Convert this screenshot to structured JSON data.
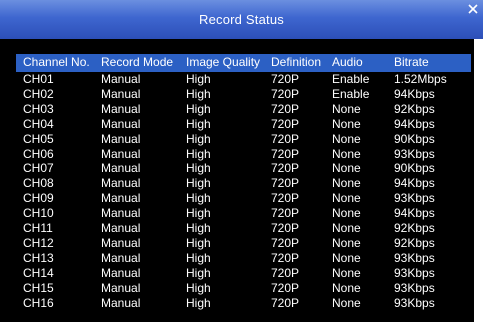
{
  "window": {
    "title": "Record Status",
    "close_icon": "close-icon"
  },
  "table": {
    "headers": [
      "Channel No.",
      "Record Mode",
      "Image Quality",
      "Definition",
      "Audio",
      "Bitrate"
    ],
    "rows": [
      [
        "CH01",
        "Manual",
        "High",
        "720P",
        "Enable",
        "1.52Mbps"
      ],
      [
        "CH02",
        "Manual",
        "High",
        "720P",
        "Enable",
        "94Kbps"
      ],
      [
        "CH03",
        "Manual",
        "High",
        "720P",
        "None",
        "92Kbps"
      ],
      [
        "CH04",
        "Manual",
        "High",
        "720P",
        "None",
        "94Kbps"
      ],
      [
        "CH05",
        "Manual",
        "High",
        "720P",
        "None",
        "90Kbps"
      ],
      [
        "CH06",
        "Manual",
        "High",
        "720P",
        "None",
        "93Kbps"
      ],
      [
        "CH07",
        "Manual",
        "High",
        "720P",
        "None",
        "90Kbps"
      ],
      [
        "CH08",
        "Manual",
        "High",
        "720P",
        "None",
        "94Kbps"
      ],
      [
        "CH09",
        "Manual",
        "High",
        "720P",
        "None",
        "93Kbps"
      ],
      [
        "CH10",
        "Manual",
        "High",
        "720P",
        "None",
        "94Kbps"
      ],
      [
        "CH11",
        "Manual",
        "High",
        "720P",
        "None",
        "92Kbps"
      ],
      [
        "CH12",
        "Manual",
        "High",
        "720P",
        "None",
        "92Kbps"
      ],
      [
        "CH13",
        "Manual",
        "High",
        "720P",
        "None",
        "93Kbps"
      ],
      [
        "CH14",
        "Manual",
        "High",
        "720P",
        "None",
        "93Kbps"
      ],
      [
        "CH15",
        "Manual",
        "High",
        "720P",
        "None",
        "93Kbps"
      ],
      [
        "CH16",
        "Manual",
        "High",
        "720P",
        "None",
        "93Kbps"
      ]
    ]
  },
  "colors": {
    "title_bar": "#3e66cf",
    "header_row": "#2c60c4",
    "background": "#000000",
    "text": "#ffffff"
  }
}
